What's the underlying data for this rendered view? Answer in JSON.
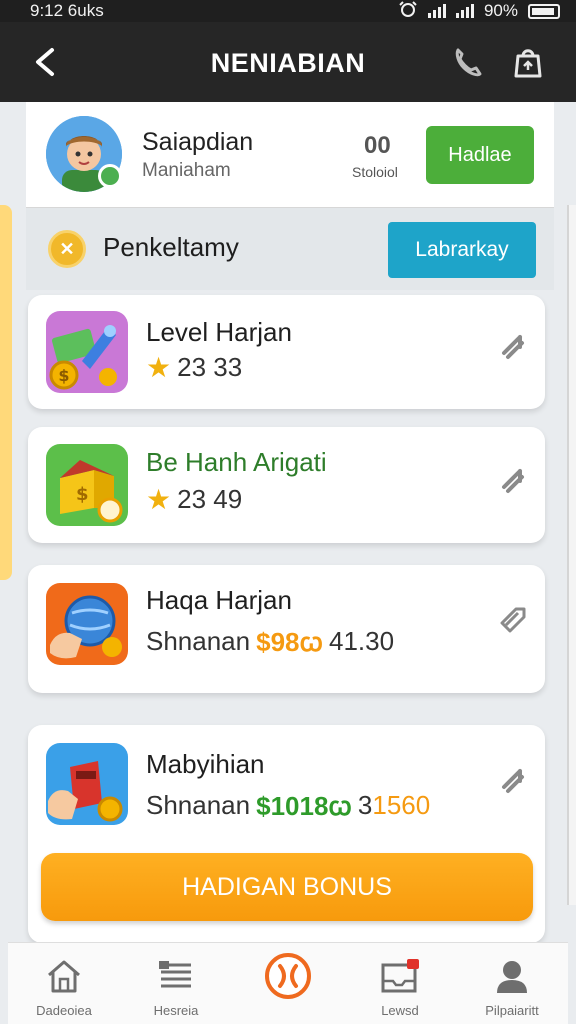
{
  "status_bar": {
    "time": "9:12 6uks",
    "battery": "90%"
  },
  "header": {
    "title": "NENIABIAN"
  },
  "profile": {
    "name": "Saiapdian",
    "subtitle": "Maniaham",
    "stat_icon": "00",
    "stat_label": "Stoloiol",
    "button_label": "Hadlae"
  },
  "section": {
    "title": "Penkeltamy",
    "button_label": "Labrarkay"
  },
  "items": [
    {
      "title": "Level Harjan",
      "rating": "23 33",
      "icon": "rocket-coin-icon",
      "title_color": "#1f1f1f"
    },
    {
      "title": "Be Hanh Arigati",
      "rating": "23 49",
      "icon": "gift-box-icon",
      "title_color": "#2e7d2a"
    },
    {
      "title": "Haqa Harjan",
      "label": "Shnanan",
      "price": "$98ꞷ",
      "amount": "41.30",
      "icon": "globe-hand-icon"
    },
    {
      "title": "Mabyihian",
      "label": "Shnanan",
      "price": "$1018ꞷ",
      "amount_a": "3",
      "amount_b": "1560",
      "icon": "mailbox-hand-icon"
    }
  ],
  "bonus_button": {
    "label": "HADIGAN BONUS"
  },
  "nav": [
    {
      "label": "Dadeoiea",
      "icon": "home-icon"
    },
    {
      "label": "Hesreia",
      "icon": "list-icon"
    },
    {
      "label": "",
      "icon": "center-x-icon"
    },
    {
      "label": "Lewsd",
      "icon": "inbox-icon"
    },
    {
      "label": "Pilpaiaritt",
      "icon": "profile-icon"
    }
  ],
  "colors": {
    "header": "#262626",
    "green": "#4cae3a",
    "teal": "#1ea4c9",
    "orange": "#f79a0c"
  }
}
